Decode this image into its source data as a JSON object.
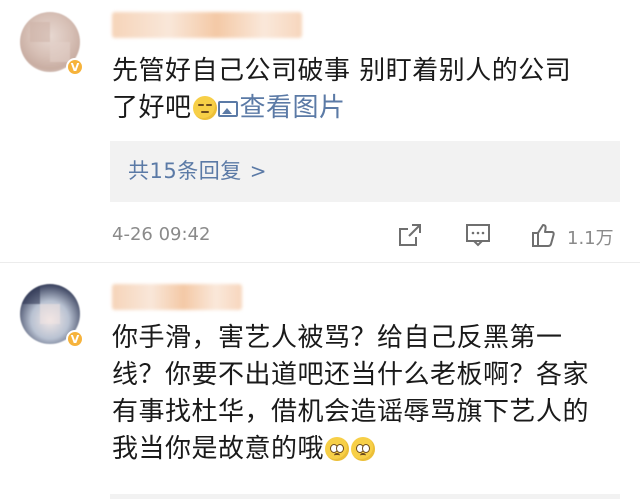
{
  "comments": [
    {
      "text_line1": "先管好自己公司破事 别盯着别人的公司",
      "text_line2": "了好吧",
      "emoji": "smirk-emoji",
      "view_picture_label": "查看图片",
      "replies_label": "共15条回复",
      "replies_chevron": ">",
      "timestamp": "4-26 09:42",
      "like_count": "1.1万",
      "badge": "V"
    },
    {
      "text": "你手滑，害艺人被骂？给自己反黑第一线？你要不出道吧还当什么老板啊？各家有事找杜华，借机会造谣辱骂旗下艺人的我当你是故意的哦",
      "emojis": [
        "pleading-emoji",
        "pleading-emoji"
      ],
      "badge": "V"
    }
  ],
  "colors": {
    "link": "#5b7aa6",
    "meta_gray": "#8a8a8a",
    "reply_bg": "#f2f2f2",
    "badge": "#f6b33c"
  }
}
